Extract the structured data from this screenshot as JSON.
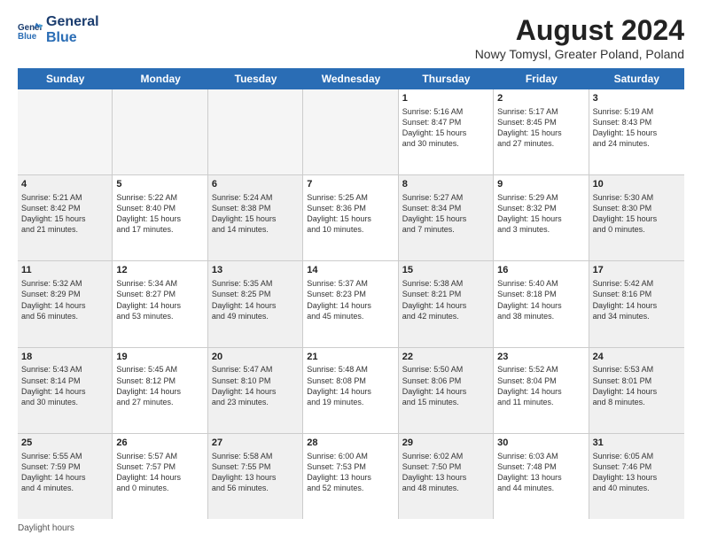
{
  "logo": {
    "line1": "General",
    "line2": "Blue"
  },
  "title": "August 2024",
  "location": "Nowy Tomysl, Greater Poland, Poland",
  "days_of_week": [
    "Sunday",
    "Monday",
    "Tuesday",
    "Wednesday",
    "Thursday",
    "Friday",
    "Saturday"
  ],
  "footer": "Daylight hours",
  "weeks": [
    [
      {
        "day": "",
        "info": "",
        "shaded": true
      },
      {
        "day": "",
        "info": "",
        "shaded": true
      },
      {
        "day": "",
        "info": "",
        "shaded": true
      },
      {
        "day": "",
        "info": "",
        "shaded": true
      },
      {
        "day": "1",
        "info": "Sunrise: 5:16 AM\nSunset: 8:47 PM\nDaylight: 15 hours\nand 30 minutes.",
        "shaded": false
      },
      {
        "day": "2",
        "info": "Sunrise: 5:17 AM\nSunset: 8:45 PM\nDaylight: 15 hours\nand 27 minutes.",
        "shaded": false
      },
      {
        "day": "3",
        "info": "Sunrise: 5:19 AM\nSunset: 8:43 PM\nDaylight: 15 hours\nand 24 minutes.",
        "shaded": false
      }
    ],
    [
      {
        "day": "4",
        "info": "Sunrise: 5:21 AM\nSunset: 8:42 PM\nDaylight: 15 hours\nand 21 minutes.",
        "shaded": true
      },
      {
        "day": "5",
        "info": "Sunrise: 5:22 AM\nSunset: 8:40 PM\nDaylight: 15 hours\nand 17 minutes.",
        "shaded": false
      },
      {
        "day": "6",
        "info": "Sunrise: 5:24 AM\nSunset: 8:38 PM\nDaylight: 15 hours\nand 14 minutes.",
        "shaded": true
      },
      {
        "day": "7",
        "info": "Sunrise: 5:25 AM\nSunset: 8:36 PM\nDaylight: 15 hours\nand 10 minutes.",
        "shaded": false
      },
      {
        "day": "8",
        "info": "Sunrise: 5:27 AM\nSunset: 8:34 PM\nDaylight: 15 hours\nand 7 minutes.",
        "shaded": true
      },
      {
        "day": "9",
        "info": "Sunrise: 5:29 AM\nSunset: 8:32 PM\nDaylight: 15 hours\nand 3 minutes.",
        "shaded": false
      },
      {
        "day": "10",
        "info": "Sunrise: 5:30 AM\nSunset: 8:30 PM\nDaylight: 15 hours\nand 0 minutes.",
        "shaded": true
      }
    ],
    [
      {
        "day": "11",
        "info": "Sunrise: 5:32 AM\nSunset: 8:29 PM\nDaylight: 14 hours\nand 56 minutes.",
        "shaded": true
      },
      {
        "day": "12",
        "info": "Sunrise: 5:34 AM\nSunset: 8:27 PM\nDaylight: 14 hours\nand 53 minutes.",
        "shaded": false
      },
      {
        "day": "13",
        "info": "Sunrise: 5:35 AM\nSunset: 8:25 PM\nDaylight: 14 hours\nand 49 minutes.",
        "shaded": true
      },
      {
        "day": "14",
        "info": "Sunrise: 5:37 AM\nSunset: 8:23 PM\nDaylight: 14 hours\nand 45 minutes.",
        "shaded": false
      },
      {
        "day": "15",
        "info": "Sunrise: 5:38 AM\nSunset: 8:21 PM\nDaylight: 14 hours\nand 42 minutes.",
        "shaded": true
      },
      {
        "day": "16",
        "info": "Sunrise: 5:40 AM\nSunset: 8:18 PM\nDaylight: 14 hours\nand 38 minutes.",
        "shaded": false
      },
      {
        "day": "17",
        "info": "Sunrise: 5:42 AM\nSunset: 8:16 PM\nDaylight: 14 hours\nand 34 minutes.",
        "shaded": true
      }
    ],
    [
      {
        "day": "18",
        "info": "Sunrise: 5:43 AM\nSunset: 8:14 PM\nDaylight: 14 hours\nand 30 minutes.",
        "shaded": true
      },
      {
        "day": "19",
        "info": "Sunrise: 5:45 AM\nSunset: 8:12 PM\nDaylight: 14 hours\nand 27 minutes.",
        "shaded": false
      },
      {
        "day": "20",
        "info": "Sunrise: 5:47 AM\nSunset: 8:10 PM\nDaylight: 14 hours\nand 23 minutes.",
        "shaded": true
      },
      {
        "day": "21",
        "info": "Sunrise: 5:48 AM\nSunset: 8:08 PM\nDaylight: 14 hours\nand 19 minutes.",
        "shaded": false
      },
      {
        "day": "22",
        "info": "Sunrise: 5:50 AM\nSunset: 8:06 PM\nDaylight: 14 hours\nand 15 minutes.",
        "shaded": true
      },
      {
        "day": "23",
        "info": "Sunrise: 5:52 AM\nSunset: 8:04 PM\nDaylight: 14 hours\nand 11 minutes.",
        "shaded": false
      },
      {
        "day": "24",
        "info": "Sunrise: 5:53 AM\nSunset: 8:01 PM\nDaylight: 14 hours\nand 8 minutes.",
        "shaded": true
      }
    ],
    [
      {
        "day": "25",
        "info": "Sunrise: 5:55 AM\nSunset: 7:59 PM\nDaylight: 14 hours\nand 4 minutes.",
        "shaded": true
      },
      {
        "day": "26",
        "info": "Sunrise: 5:57 AM\nSunset: 7:57 PM\nDaylight: 14 hours\nand 0 minutes.",
        "shaded": false
      },
      {
        "day": "27",
        "info": "Sunrise: 5:58 AM\nSunset: 7:55 PM\nDaylight: 13 hours\nand 56 minutes.",
        "shaded": true
      },
      {
        "day": "28",
        "info": "Sunrise: 6:00 AM\nSunset: 7:53 PM\nDaylight: 13 hours\nand 52 minutes.",
        "shaded": false
      },
      {
        "day": "29",
        "info": "Sunrise: 6:02 AM\nSunset: 7:50 PM\nDaylight: 13 hours\nand 48 minutes.",
        "shaded": true
      },
      {
        "day": "30",
        "info": "Sunrise: 6:03 AM\nSunset: 7:48 PM\nDaylight: 13 hours\nand 44 minutes.",
        "shaded": false
      },
      {
        "day": "31",
        "info": "Sunrise: 6:05 AM\nSunset: 7:46 PM\nDaylight: 13 hours\nand 40 minutes.",
        "shaded": true
      }
    ]
  ]
}
